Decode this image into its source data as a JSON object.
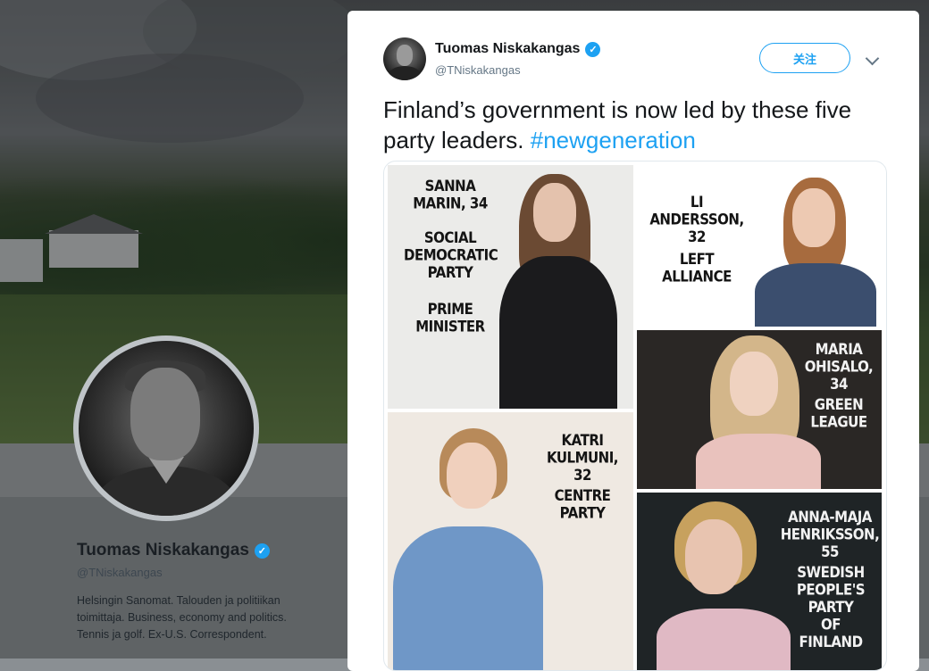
{
  "profile": {
    "name": "Tuomas Niskakangas",
    "handle": "@TNiskakangas",
    "bio": "Helsingin Sanomat. Talouden ja politiikan toimittaja. Business, economy and politics. Tennis ja golf. Ex-U.S. Correspondent."
  },
  "tweet": {
    "author_name": "Tuomas Niskakangas",
    "author_handle": "@TNiskakangas",
    "follow_label": "关注",
    "text": "Finland’s government is now led by these five party leaders.",
    "hashtag": "#newgeneration"
  },
  "media": {
    "captions": {
      "marin_name": "SANNA\nMARIN, 34",
      "marin_party": "SOCIAL\nDEMOCRATIC\nPARTY",
      "marin_role": "PRIME\nMINISTER",
      "andersson_name": "LI\nANDERSSON, 32",
      "andersson_party": "LEFT\nALLIANCE",
      "ohisalo_name": "MARIA\nOHISALO, 34",
      "ohisalo_party": "GREEN\nLEAGUE",
      "kulmuni_name": "KATRI\nKULMUNI, 32",
      "kulmuni_party": "CENTRE\nPARTY",
      "henriksson_name": "ANNA-MAJA\nHENRIKSSON, 55",
      "henriksson_party": "SWEDISH\nPEOPLE'S\nPARTY\nOF FINLAND"
    }
  },
  "icons": {
    "verified": "verified-badge-icon",
    "chevron": "chevron-down-icon"
  },
  "colors": {
    "accent": "#1da1f2",
    "text": "#14171a",
    "secondary": "#657786"
  }
}
